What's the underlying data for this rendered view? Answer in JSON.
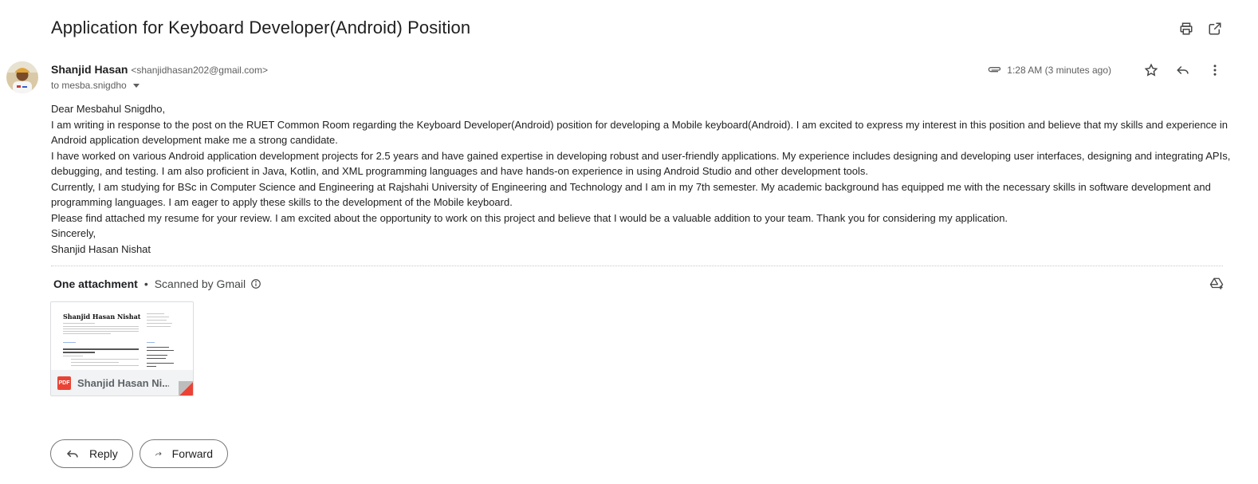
{
  "email": {
    "subject": "Application for Keyboard Developer(Android) Position",
    "sender_name": "Shanjid Hasan",
    "sender_email": "<shanjidhasan202@gmail.com>",
    "recipient": "to mesba.snigdho",
    "timestamp": "1:28 AM (3 minutes ago)",
    "body": [
      "Dear Mesbahul Snigdho,",
      "I am writing in response to the post on the RUET Common Room regarding the Keyboard Developer(Android) position for developing a Mobile keyboard(Android). I am excited to express my interest in this position and believe that my skills and experience in Android application development make me a strong candidate.",
      "I have worked on various Android application development projects for 2.5 years and have gained expertise in developing robust and user-friendly applications. My experience includes designing and developing user interfaces, designing and integrating APIs, debugging, and testing. I am also proficient in Java, Kotlin, and XML programming languages and have hands-on experience in using Android Studio and other development tools.",
      "Currently, I am studying for BSc in Computer Science and Engineering at Rajshahi University of Engineering and Technology and I am in my 7th semester. My academic background has equipped me with the necessary skills in software development and programming languages. I am eager to apply these skills to the development of the Mobile keyboard.",
      "Please find attached my resume for your review. I am excited about the opportunity to work on this project and believe that I would be a valuable addition to your team. Thank you for considering my application.",
      "Sincerely,",
      "Shanjid Hasan Nishat"
    ]
  },
  "attachments": {
    "title": "One attachment",
    "separator": "•",
    "scanned": "Scanned by Gmail",
    "file_name": "Shanjid Hasan Ni...",
    "file_type": "PDF",
    "thumbnail_heading": "Shanjid Hasan Nishat"
  },
  "actions": {
    "reply": "Reply",
    "forward": "Forward"
  },
  "icons": {
    "print": "print-icon",
    "open_new": "open-in-new-icon",
    "attachment": "paperclip-icon",
    "star": "star-icon",
    "reply": "reply-icon",
    "more": "more-vert-icon",
    "info": "info-icon",
    "drive": "add-to-drive-icon",
    "forward": "forward-icon"
  },
  "colors": {
    "pdf_badge": "#ea4335",
    "text": "#202124",
    "muted": "#5e5e5e",
    "border": "#747775"
  }
}
